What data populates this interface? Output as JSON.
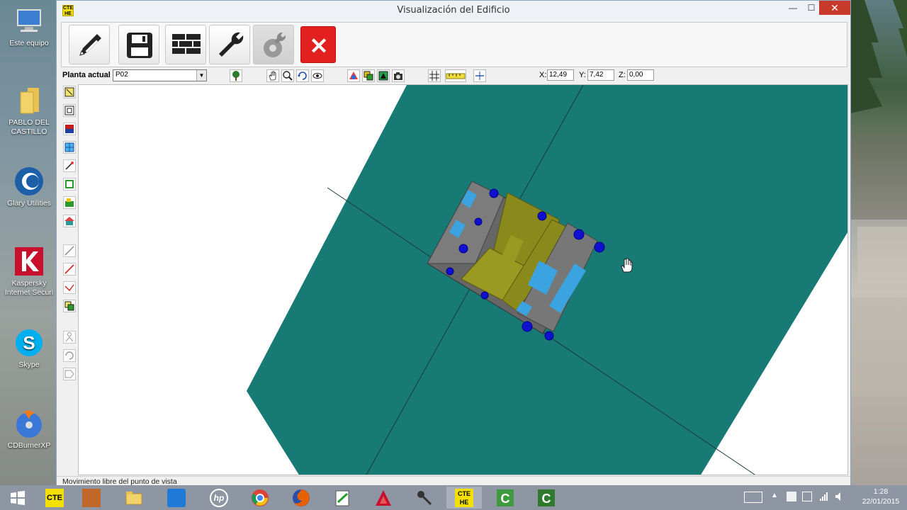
{
  "desktop": {
    "icons": [
      {
        "label": "Este equipo"
      },
      {
        "label": "PABLO DEL CASTILLO"
      },
      {
        "label": "Glary Utilities"
      },
      {
        "label": "Kaspersky Internet Securi"
      },
      {
        "label": "Skype"
      },
      {
        "label": "CDBurnerXP"
      }
    ]
  },
  "window": {
    "app_icon_text": "CTE HE",
    "title": "Visualización del Edificio",
    "min_label": "—",
    "max_label": "☐",
    "close_label": "✕"
  },
  "toolbar": {
    "buttons": [
      {
        "name": "edit",
        "icon": "pencil-icon"
      },
      {
        "name": "save",
        "icon": "floppy-disk-icon"
      },
      {
        "name": "walls",
        "icon": "brick-wall-icon"
      },
      {
        "name": "tools",
        "icon": "wrench-icon"
      },
      {
        "name": "settings",
        "icon": "gear-wrench-icon"
      },
      {
        "name": "exit",
        "icon": "close-icon",
        "label": "✕"
      }
    ]
  },
  "options": {
    "planta_label": "Planta actual",
    "planta_value": "P02",
    "coords": {
      "x_label": "X:",
      "x_value": "12,49",
      "y_label": "Y:",
      "y_value": "7,42",
      "z_label": "Z:",
      "z_value": "0,00"
    }
  },
  "status": {
    "text": "Movimiento libre del punto de vista"
  },
  "colors": {
    "ground": "#177a74",
    "roof": "#8a8a1c",
    "slab": "#7a7a7a",
    "window_blue": "#3aa3e0",
    "pillar": "#1010d0",
    "exit_button": "#e32020"
  },
  "taskbar": {
    "items": [
      {
        "name": "start",
        "icon": "windows-logo-icon"
      },
      {
        "name": "cte",
        "icon": "cte-app-icon",
        "label": "CTE"
      },
      {
        "name": "app2",
        "icon": "app-icon"
      },
      {
        "name": "explorer",
        "icon": "folder-icon"
      },
      {
        "name": "maxthon",
        "icon": "browser-icon"
      },
      {
        "name": "hp",
        "icon": "hp-icon",
        "label": "hp"
      },
      {
        "name": "chrome",
        "icon": "chrome-icon"
      },
      {
        "name": "firefox",
        "icon": "firefox-icon"
      },
      {
        "name": "notes",
        "icon": "notepad-icon"
      },
      {
        "name": "autocad",
        "icon": "autocad-icon"
      },
      {
        "name": "mic",
        "icon": "microphone-icon"
      },
      {
        "name": "cte-he",
        "icon": "cte-he-icon",
        "label": "CTE HE"
      },
      {
        "name": "camtasia",
        "icon": "camtasia-icon"
      },
      {
        "name": "camtasia2",
        "icon": "camtasia-icon"
      }
    ],
    "time": "1:28",
    "date": "22/01/2015"
  }
}
